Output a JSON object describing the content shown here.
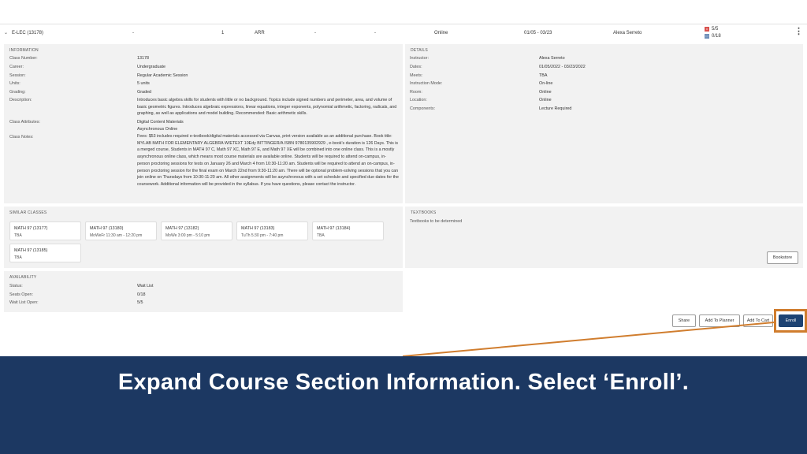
{
  "section_row": {
    "section": "E-LEC (13178)",
    "col2": "-",
    "col3": "1",
    "col4": "ARR",
    "col5": "-",
    "col6": "-",
    "mode": "Online",
    "dates": "01/05 - 03/23",
    "instructor": "Alexa Serreto",
    "seats_a": "5/5",
    "seats_b": "0/18",
    "badge_a_color": "#d9534f",
    "badge_b_color": "#6f8fb8",
    "badge_a_glyph": "x",
    "badge_b_glyph": "□",
    "menu_icon": "⋮",
    "chevron": "⌄"
  },
  "information": {
    "title": "INFORMATION",
    "rows": [
      {
        "label": "Class Number:",
        "value": "13178"
      },
      {
        "label": "Career:",
        "value": "Undergraduate"
      },
      {
        "label": "Session:",
        "value": "Regular Academic Session"
      },
      {
        "label": "Units:",
        "value": "5 units"
      },
      {
        "label": "Grading:",
        "value": "Graded"
      }
    ],
    "description_label": "Description:",
    "description": "Introduces basic algebra skills for students with little or no background. Topics include signed numbers and perimeter, area, and volume of basic geometric figures. Introduces algebraic expressions, linear equations, integer exponents, polynomial arithmetic, factoring, radicals, and graphing, as well as applications and model building. Recommended: Basic arithmetic skills.",
    "attributes_label": "Class Attributes:",
    "attributes": [
      "Digital Content Materials",
      "Asynchronous Online"
    ],
    "notes_label": "Class Notes:",
    "notes": "Fees: $53 includes required e-textbook/digital materials accessed via Canvas, print version available as an additional purchase. Book title: MYLAB MATH FOR ELEMENTARY ALGEBRA W/ETEXT 10Edy BITTINGER/A ISBN 9780135902929 , e-book's duration is 126 Days. This is a merged course, Students in MATH 97 C, Math 97 XC, Math 97 E, and Math 97 XE will be combined into one online class. This is a mostly asynchronous online class, which means most course materials are available online. Students will be required to attend on-campus, in-person proctoring sessions for tests on January 26 and March 4 from 10:30-11:20 am. Students will be required to attend an on-campus, in-person proctoring session for the final exam on March 22nd from 9:30-11:20 am. There will be optional problem-solving sessions that you can join online on Thursdays from 10:30-11:20 am. All other assignments will be asynchronous with a set schedule and specified due dates for the coursework. Additional information will be provided in the syllabus. If you have questions, please contact the instructor."
  },
  "details": {
    "title": "DETAILS",
    "rows": [
      {
        "label": "Instructor:",
        "value": "Alexa Serreto"
      },
      {
        "label": "Dates:",
        "value": "01/05/2022 - 03/23/2022"
      },
      {
        "label": "Meets:",
        "value": "TBA"
      },
      {
        "label": "Instruction Mode:",
        "value": "On-line"
      },
      {
        "label": "Room:",
        "value": "Online"
      },
      {
        "label": "Location:",
        "value": "Online"
      },
      {
        "label": "Components:",
        "value": "Lecture Required"
      }
    ]
  },
  "similar": {
    "title": "SIMILAR CLASSES",
    "cards": [
      {
        "title": "MATH 97 (13177)",
        "sub": "TBA"
      },
      {
        "title": "MATH 97 (13180)",
        "sub": "MoWeFr 11:30 am - 12:20 pm"
      },
      {
        "title": "MATH 97 (13182)",
        "sub": "MoWe 3:00 pm - 5:10 pm"
      },
      {
        "title": "MATH 97 (13183)",
        "sub": "TuTh 5:30 pm - 7:40 pm"
      },
      {
        "title": "MATH 97 (13184)",
        "sub": "TBA"
      },
      {
        "title": "MATH 97 (13185)",
        "sub": "TBA"
      }
    ]
  },
  "textbooks": {
    "title": "TEXTBOOKS",
    "text": "Textbooks to be determined",
    "bookstore_label": "Bookstore"
  },
  "availability": {
    "title": "AVAILABILITY",
    "rows": [
      {
        "label": "Status:",
        "value": "Wait List"
      },
      {
        "label": "Seats Open:",
        "value": "0/18"
      },
      {
        "label": "Wait List Open:",
        "value": "5/5"
      }
    ]
  },
  "actions": {
    "share": "Share",
    "add_planner": "Add To Planner",
    "add_cart": "Add To Cart",
    "enroll": "Enroll"
  },
  "banner": {
    "text": "Expand Course Section Information. Select ‘Enroll’.",
    "accent": "#d07d2e",
    "background": "#1c3862"
  }
}
